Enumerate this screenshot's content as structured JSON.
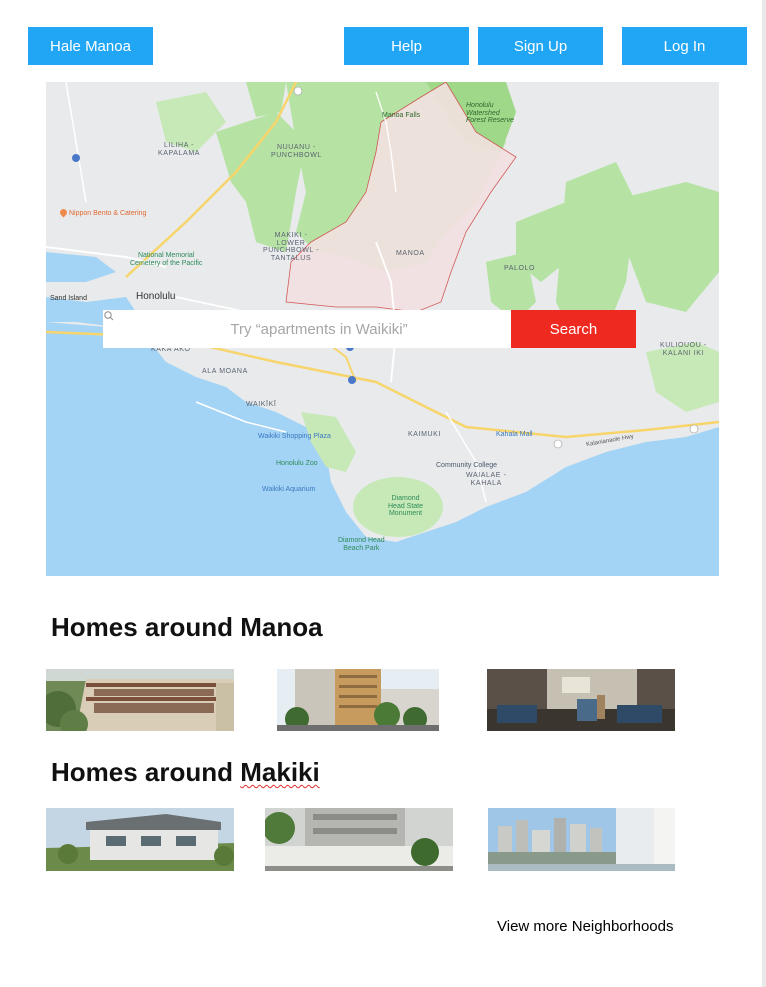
{
  "nav": {
    "brand": "Hale Manoa",
    "help": "Help",
    "signup": "Sign Up",
    "login": "Log In"
  },
  "search": {
    "placeholder": "Try “apartments in Waikiki”",
    "button": "Search"
  },
  "map": {
    "cities": {
      "honolulu": "Honolulu",
      "sand_island": "Sand Island"
    },
    "areas": {
      "liliha": "LILIHA -\nKAPALAMA",
      "nuuanu": "NUUANU -\nPUNCHBOWL",
      "makiki_lower": "MAKIKI -\nLOWER\nPUNCHBOWL -\nTANTALUS",
      "manoa": "MANOA",
      "palolo": "PALOLO",
      "kakaako": "KAKA'AKO",
      "ala_moana": "ALA MOANA",
      "waikiki": "WAIKĪKĪ",
      "kaimuki": "KAIMUKI",
      "waialae": "WAIALAE -\nKAHALA",
      "kuliouou": "KULIOUOU -\nKALANI IKI"
    },
    "pois": {
      "nippon": "Nippon Bento & Catering",
      "cemetery": "National Memorial\nCemetery of the Pacific",
      "manoa_falls": "Manoa Falls",
      "watershed": "Honolulu\nWatershed\nForest Reserve",
      "waikiki_plaza": "Waikiki Shopping Plaza",
      "zoo": "Honolulu Zoo",
      "aquarium": "Waikiki Aquarium",
      "community_college": "Community College",
      "kahala_mall": "Kahala Mall",
      "diamond_head": "Diamond\nHead State\nMonument",
      "dh_beach": "Diamond Head\nBeach Park",
      "highway": "Kalanianaole Hwy"
    }
  },
  "sections": [
    {
      "title": "Homes around Manoa"
    },
    {
      "title_prefix": "Homes around ",
      "title_word": "Makiki"
    }
  ],
  "footer": {
    "view_more": "View more Neighborhoods"
  },
  "colors": {
    "nav_blue": "#21a6f5",
    "search_red": "#ee2a20",
    "water": "#a4d4f5",
    "park": "#b6e3a4"
  }
}
